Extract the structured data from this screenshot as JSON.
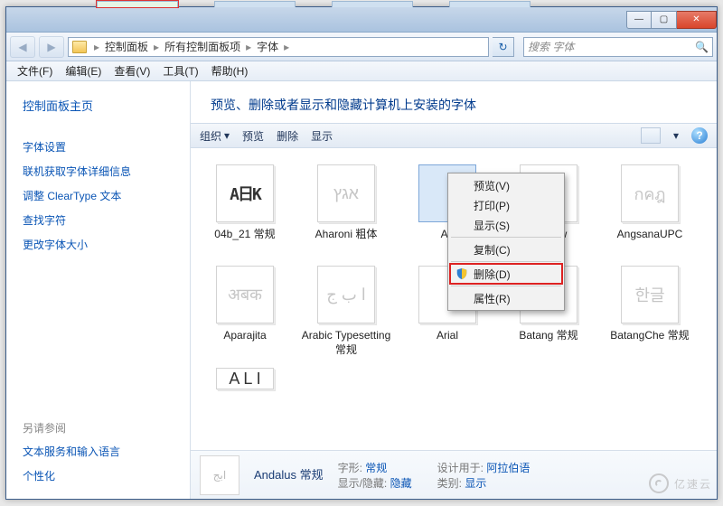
{
  "window_controls": {
    "min": "—",
    "max": "▢",
    "close": "✕"
  },
  "nav": {
    "back": "◀",
    "forward": "▶"
  },
  "breadcrumbs": {
    "p0": "控制面板",
    "p1": "所有控制面板项",
    "p2": "字体",
    "sep": "▸"
  },
  "search": {
    "placeholder": "搜索 字体"
  },
  "menubar": {
    "file": "文件(F)",
    "edit": "编辑(E)",
    "view": "查看(V)",
    "tools": "工具(T)",
    "help": "帮助(H)"
  },
  "sidebar": {
    "home": "控制面板主页",
    "links": {
      "l0": "字体设置",
      "l1": "联机获取字体详细信息",
      "l2": "调整 ClearType 文本",
      "l3": "查找字符",
      "l4": "更改字体大小"
    },
    "also_heading": "另请参阅",
    "also": {
      "a0": "文本服务和输入语言",
      "a1": "个性化"
    }
  },
  "page_title": "预览、删除或者显示和隐藏计算机上安装的字体",
  "toolbar": {
    "organize": "组织",
    "preview": "预览",
    "delete": "删除",
    "show": "显示",
    "caret": "▾",
    "help": "?"
  },
  "fonts": {
    "r0": {
      "f0": {
        "glyph": "A日K",
        "label": "04b_21 常规"
      },
      "f1": {
        "glyph": "אגץ",
        "label": "Aharoni 粗体"
      },
      "f2": {
        "glyph": "",
        "label": "An"
      },
      "f3": {
        "glyph": "ทคอ",
        "label": "na New"
      },
      "f4": {
        "glyph": "กคฎ",
        "label": "AngsanaUPC"
      }
    },
    "r1": {
      "f0": {
        "glyph": "अबक",
        "label": "Aparajita"
      },
      "f1": {
        "glyph": "ا ب ج",
        "label": "Arabic Typesetting 常规"
      },
      "f2": {
        "glyph": "",
        "label": "Arial"
      },
      "f3": {
        "glyph": "한글",
        "label": "Batang 常规"
      },
      "f4": {
        "glyph": "한글",
        "label": "BatangChe 常规"
      }
    },
    "r2": {
      "f0": {
        "glyph": "A L I",
        "label": ""
      }
    }
  },
  "context_menu": {
    "preview": "预览(V)",
    "print": "打印(P)",
    "show": "显示(S)",
    "copy": "复制(C)",
    "delete": "删除(D)",
    "props": "属性(R)"
  },
  "details": {
    "name": "Andalus 常规",
    "style_label": "字形:",
    "style_val": "常规",
    "hide_label": "显示/隐藏:",
    "hide_val": "隐藏",
    "designed_label": "设计用于:",
    "designed_val": "阿拉伯语",
    "category_label": "类别:",
    "category_val": "显示",
    "thumb_glyph": "ابج"
  },
  "watermark": "亿速云"
}
